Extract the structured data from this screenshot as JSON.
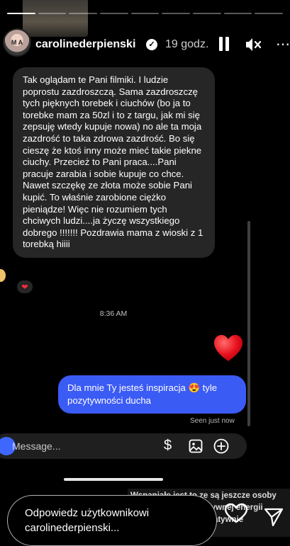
{
  "story": {
    "segments_total": 9,
    "segments_done": 1,
    "username": "carolinederpienski",
    "time_ago": "19 godz.",
    "avatar_text": "M A"
  },
  "chat": {
    "incoming_message": "Tak oglądam te Pani filmiki. I ludzie poprostu zazdroszczą. Sama zazdroszczę tych pięknych torebek i ciuchów (bo ja to torebke mam za 50zl i to z targu, jak mi się zepsuję wtedy kupuje nowa) no ale ta moja zazdrość to taka zdrowa zazdrość. Bo się cieszę że ktoś inny może mieć takie piekne ciuchy. Przecież to Pani praca....Pani pracuje zarabia i sobie kupuje co chce. Nawet szczękę ze złota może sobie Pani kupić. To właśnie zarobione ciężko pieniądze! Więc nie rozumiem tych chciwych ludzi....ja życzę wszystkiego dobrego !!!!!!! Pozdrawia mama z wioski z 1 torebką hiiii",
    "reaction": "❤",
    "timestamp": "8:36 AM",
    "outgoing_message": "Dla mnie Ty jesteś inspiracja 😍 tyle pozytywności ducha",
    "seen_label": "Seen just now",
    "compose_placeholder": "Message...",
    "dollar_glyph": "$"
  },
  "overlay": {
    "line1": "Wspaniałe jest to ze są jeszcze osoby",
    "line2": "które mają tyle pozytywnej energii",
    "line3": "i nie zazdroszczą negatywnie"
  },
  "reply": {
    "placeholder": "Odpowiedz użytkownikowi carolinederpienski..."
  },
  "colors": {
    "outgoing_bubble": "#3b5bf5",
    "incoming_bubble": "#262626",
    "heart": "#ff2a3b"
  }
}
